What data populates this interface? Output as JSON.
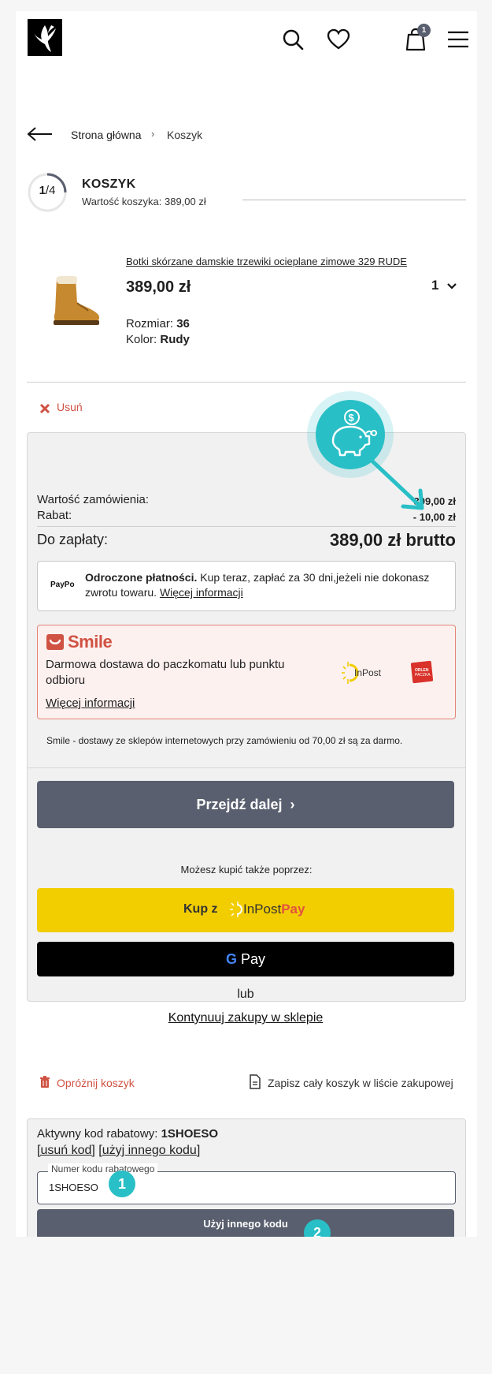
{
  "header": {
    "cart_count": "1",
    "icons": [
      "logo",
      "search-icon",
      "heart-icon",
      "cart-icon",
      "menu-icon"
    ]
  },
  "breadcrumb": {
    "home": "Strona główna",
    "separator": "›",
    "current": "Koszyk"
  },
  "step": {
    "current": "1",
    "total": "4",
    "progress": 0.25,
    "title": "KOSZYK",
    "subtitle": "Wartość koszyka: 389,00 zł"
  },
  "product": {
    "name": "Botki skórzane damskie trzewiki ocieplane zimowe 329 RUDE",
    "price": "389,00 zł",
    "quantity": "1",
    "size_label": "Rozmiar:",
    "size_value": "36",
    "color_label": "Kolor:",
    "color_value": "Rudy",
    "remove_label": "Usuń"
  },
  "summary": {
    "order_value_label": "Wartość zamówienia:",
    "order_value": "399,00 zł",
    "discount_label": "Rabat:",
    "discount_value": "- 10,00 zł",
    "to_pay_label": "Do zapłaty:",
    "to_pay_value": "389,00 zł brutto",
    "paypo": {
      "logo": "PayPo",
      "bold": "Odroczone płatności.",
      "text": " Kup teraz, zapłać za 30 dni,jeżeli nie dokonasz zwrotu towaru. ",
      "link": "Więcej informacji"
    },
    "smile": {
      "brand": "Smile",
      "desc": "Darmowa dostawa do paczkomatu lub punktu odbioru",
      "link": "Więcej informacji",
      "inpost": "InPost",
      "orlen": "ORLEN PACZKA",
      "note": "Smile - dostawy ze sklepów internetowych przy zamówieniu od 70,00 zł są za darmo."
    },
    "next_button": "Przejdź dalej",
    "also_text": "Możesz kupić także poprzez:",
    "inpost_pay": {
      "prefix": "Kup z",
      "brand_a": "InPost",
      "brand_b": "Pay"
    },
    "gpay": {
      "g": "G",
      "pay": "Pay"
    },
    "or_text": "lub",
    "continue_link": "Kontynuuj zakupy w sklepie"
  },
  "actions": {
    "empty_cart": "Opróżnij koszyk",
    "save_list": "Zapisz cały koszyk w liście zakupowej"
  },
  "coupon": {
    "title_prefix": "Aktywny kod rabatowy: ",
    "code": "1SHOESO",
    "remove_link": "[usuń kod]",
    "other_link": "[użyj innego kodu]",
    "field_label": "Numer kodu rabatowego",
    "field_value": "1SHOESO",
    "button": "Użyj innego kodu"
  },
  "markers": [
    "1",
    "2"
  ],
  "colors": {
    "accent_dark": "#595f6e",
    "red": "#d05243",
    "teal": "#29bfc6",
    "inpost_yellow": "#f2cd00"
  }
}
